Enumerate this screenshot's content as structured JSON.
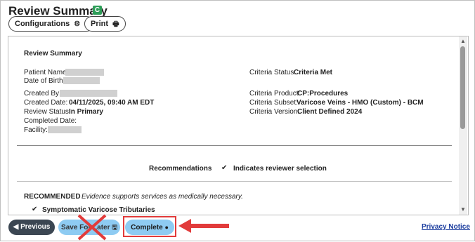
{
  "header": {
    "title": "Review Summary",
    "badge": "C",
    "configurations_label": "Configurations",
    "print_label": "Print"
  },
  "summary": {
    "heading": "Review Summary",
    "left": [
      {
        "label": "Patient Name:",
        "value": ""
      },
      {
        "label": "Date of Birth:",
        "value": ""
      },
      {
        "label": "Created By:",
        "value": ""
      },
      {
        "label": "Created Date:",
        "value": "04/11/2025, 09:40 AM EDT"
      },
      {
        "label": "Review Status:",
        "value": "In Primary"
      },
      {
        "label": "Completed Date:",
        "value": ""
      },
      {
        "label": "Facility:",
        "value": ""
      }
    ],
    "right": [
      {
        "label": "Criteria Status:",
        "value": "Criteria Met"
      },
      {
        "label": "Criteria Product:",
        "value": "CP:Procedures"
      },
      {
        "label": "Criteria Subset:",
        "value": "Varicose Veins - HMO (Custom) - BCM"
      },
      {
        "label": "Criteria Version:",
        "value": "Client Defined 2024"
      }
    ]
  },
  "recommendations": {
    "title": "Recommendations",
    "legend": "Indicates reviewer selection",
    "recommended_label": "RECOMMENDED",
    "recommended_desc": "Evidence supports services as medically necessary.",
    "item": "Symptomatic Varicose Tributaries"
  },
  "footer": {
    "previous_label": "Previous",
    "save_label": "Save For Later",
    "complete_label": "Complete",
    "privacy_label": "Privacy Notice"
  },
  "colors": {
    "badge": "#2f9e59",
    "primary_button": "#8ecbf2",
    "previous_button": "#3b4652",
    "annotation_red": "#e23b3b",
    "link": "#1a3c9e"
  }
}
